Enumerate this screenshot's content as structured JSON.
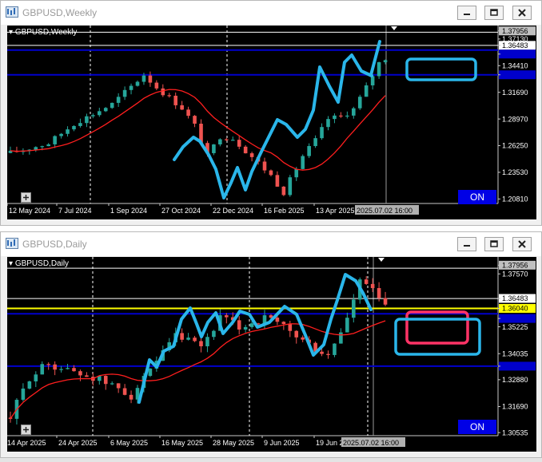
{
  "colors": {
    "bull": "#26a69a",
    "bear": "#ef5350",
    "ma": "#ff1e1e",
    "trend": "#2ab6ea",
    "hline": "#0000cc",
    "yellow": "#ffff00",
    "box_blue": "#2ab6ea",
    "box_red": "#ff3366"
  },
  "windows": [
    {
      "title": "GBPUSD,Weekly",
      "symbol_label": "GBPUSD,Weekly",
      "icons": [
        "chart-app-icon",
        "minimize-icon",
        "restore-icon",
        "close-icon"
      ],
      "y_labels": [
        "1.37956",
        "1.37130",
        "1.36483",
        "1.35595",
        "1.34410",
        "1.33480",
        "1.31690",
        "1.28970",
        "1.26250",
        "1.23530",
        "1.20810"
      ],
      "x_labels": [
        "12 May 2024",
        "7 Jul 2024",
        "1 Sep 2024",
        "27 Oct 2024",
        "22 Dec 2024",
        "16 Feb 2025",
        "13 Apr 2025",
        "2025.07.02 16:00"
      ],
      "on_label": "ON",
      "price_range": [
        1.2035,
        1.3818
      ]
    },
    {
      "title": "GBPUSD,Daily",
      "symbol_label": "GBPUSD,Daily",
      "icons": [
        "chart-app-icon",
        "minimize-icon",
        "restore-icon",
        "close-icon"
      ],
      "y_labels": [
        "1.37956",
        "1.37570",
        "1.36483",
        "1.36040",
        "1.35595",
        "1.35225",
        "1.34035",
        "1.33480",
        "1.32880",
        "1.31690",
        "1.30535"
      ],
      "x_labels": [
        "14 Apr 2025",
        "24 Apr 2025",
        "6 May 2025",
        "16 May 2025",
        "28 May 2025",
        "9 Jun 2025",
        "19 Jun 2025",
        "2025.07.02 16:00"
      ],
      "on_label": "ON",
      "price_range": [
        1.304,
        1.3818
      ]
    }
  ]
}
